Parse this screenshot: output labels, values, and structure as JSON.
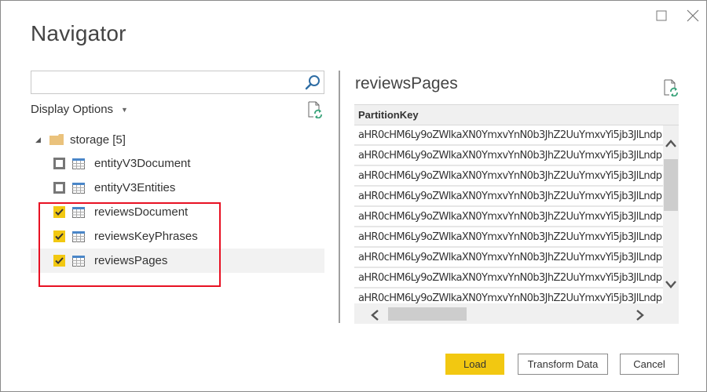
{
  "window": {
    "title": "Navigator",
    "controls": [
      "maximize",
      "close"
    ]
  },
  "left_panel": {
    "search": {
      "value": "",
      "placeholder": ""
    },
    "display_options_label": "Display Options",
    "tree": {
      "root": {
        "label": "storage [5]",
        "icon": "folder-icon",
        "expanded": true
      },
      "items": [
        {
          "label": "entityV3Document",
          "checked": false,
          "selected": false,
          "icon": "table-icon"
        },
        {
          "label": "entityV3Entities",
          "checked": false,
          "selected": false,
          "icon": "table-icon"
        },
        {
          "label": "reviewsDocument",
          "checked": true,
          "selected": false,
          "icon": "table-icon"
        },
        {
          "label": "reviewsKeyPhrases",
          "checked": true,
          "selected": false,
          "icon": "table-icon"
        },
        {
          "label": "reviewsPages",
          "checked": true,
          "selected": true,
          "icon": "table-icon"
        }
      ]
    },
    "highlight_color": "#e81123"
  },
  "preview": {
    "title": "reviewsPages",
    "columns": [
      "PartitionKey"
    ],
    "rows": [
      "aHR0cHM6Ly9oZWlkaXN0YmxvYnN0b3JhZ2UuYmxvYi5jb3JlLndp",
      "aHR0cHM6Ly9oZWlkaXN0YmxvYnN0b3JhZ2UuYmxvYi5jb3JlLndp",
      "aHR0cHM6Ly9oZWlkaXN0YmxvYnN0b3JhZ2UuYmxvYi5jb3JlLndp",
      "aHR0cHM6Ly9oZWlkaXN0YmxvYnN0b3JhZ2UuYmxvYi5jb3JlLndp",
      "aHR0cHM6Ly9oZWlkaXN0YmxvYnN0b3JhZ2UuYmxvYi5jb3JlLndp",
      "aHR0cHM6Ly9oZWlkaXN0YmxvYnN0b3JhZ2UuYmxvYi5jb3JlLndp",
      "aHR0cHM6Ly9oZWlkaXN0YmxvYnN0b3JhZ2UuYmxvYi5jb3JlLndp",
      "aHR0cHM6Ly9oZWlkaXN0YmxvYnN0b3JhZ2UuYmxvYi5jb3JlLndp",
      "aHR0cHM6Ly9oZWlkaXN0YmxvYnN0b3JhZ2UuYmxvYi5jb3JlLndp"
    ]
  },
  "footer": {
    "load_label": "Load",
    "transform_label": "Transform Data",
    "cancel_label": "Cancel"
  },
  "colors": {
    "accent": "#f2c811",
    "highlight": "#e81123",
    "refresh_green": "#3aa37a",
    "search_blue": "#2e6da4"
  }
}
